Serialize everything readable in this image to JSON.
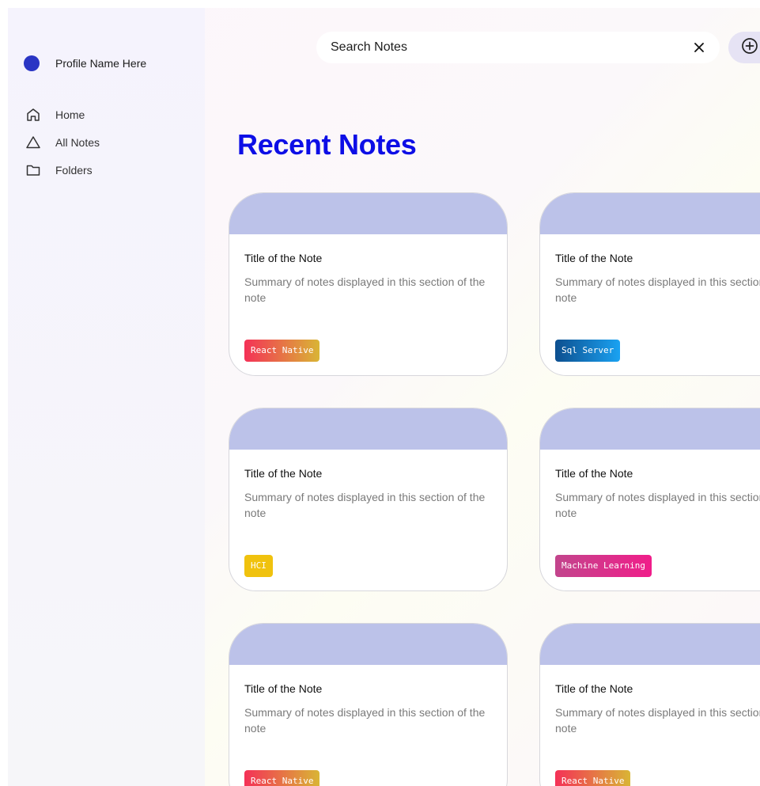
{
  "sidebar": {
    "profile_name": "Profile Name Here",
    "avatar_color": "#2a35c4",
    "items": [
      {
        "label": "Home",
        "icon": "home-icon"
      },
      {
        "label": "All Notes",
        "icon": "triangle-icon"
      },
      {
        "label": "Folders",
        "icon": "folder-icon"
      }
    ]
  },
  "search": {
    "placeholder": "Search Notes",
    "value": "",
    "clear_icon": "close-icon"
  },
  "add_button": {
    "icon": "add-circle-icon"
  },
  "main": {
    "title": "Recent Notes",
    "title_color": "#0d0ee6"
  },
  "notes": [
    {
      "title": "Title of the Note",
      "summary": "Summary of notes displayed in this section of the note",
      "tag": "React Native"
    },
    {
      "title": "Title of the Note",
      "summary": "Summary of notes displayed in this section of the note",
      "tag": "Sql Server"
    },
    {
      "title": "Title of the Note",
      "summary": "Summary of notes displayed in this section of the note",
      "tag": "HCI"
    },
    {
      "title": "Title of the Note",
      "summary": "Summary of notes displayed in this section of the note",
      "tag": "Machine Learning"
    },
    {
      "title": "Title of the Note",
      "summary": "Summary of notes displayed in this section of the note",
      "tag": "React Native"
    },
    {
      "title": "Title of the Note",
      "summary": "Summary of notes displayed in this section of the note",
      "tag": "React Native"
    }
  ]
}
